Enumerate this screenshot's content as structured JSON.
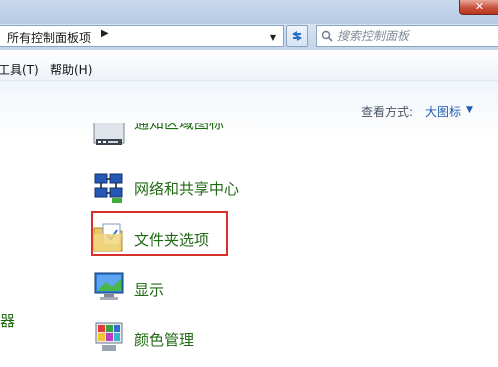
{
  "window": {
    "close_glyph": "✕"
  },
  "address_bar": {
    "breadcrumb": "所有控制面板项",
    "crumb_arrow": "▶",
    "dropdown_glyph": "▼"
  },
  "search": {
    "placeholder": "搜索控制面板"
  },
  "menu": {
    "items": [
      {
        "label": "工具(T)"
      },
      {
        "label": "帮助(H)"
      }
    ]
  },
  "view": {
    "label": "查看方式:",
    "value": "大图标",
    "caret": "▼"
  },
  "left_column": {
    "fragment": "器"
  },
  "items": [
    {
      "label": "通知区域图标",
      "icon": "notification-area-icon"
    },
    {
      "label": "网络和共享中心",
      "icon": "network-sharing-icon"
    },
    {
      "label": "文件夹选项",
      "icon": "folder-options-icon",
      "highlighted": true
    },
    {
      "label": "显示",
      "icon": "display-icon"
    },
    {
      "label": "颜色管理",
      "icon": "color-management-icon"
    }
  ],
  "colors": {
    "item_label": "#1f6a13",
    "link": "#1e5fb3",
    "highlight": "#d8302b"
  }
}
